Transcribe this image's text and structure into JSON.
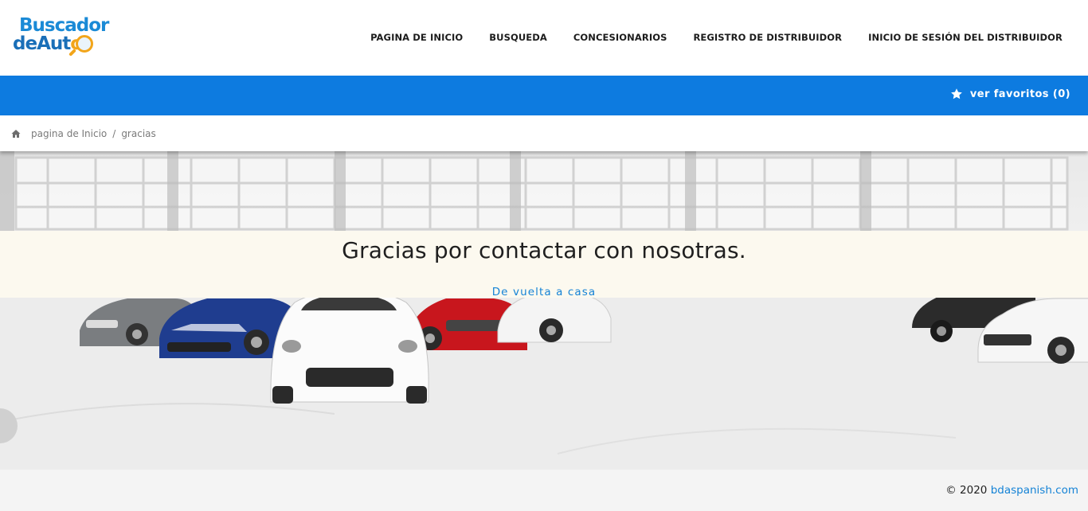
{
  "logo": {
    "line1": "Buscador",
    "line2_a": "deAut",
    "line2_b": "o"
  },
  "nav": [
    {
      "label": "PAGINA DE INICIO"
    },
    {
      "label": "BUSQUEDA"
    },
    {
      "label": "CONCESIONARIOS"
    },
    {
      "label": "REGISTRO DE DISTRIBUIDOR"
    },
    {
      "label": "INICIO DE SESIÓN DEL DISTRIBUIDOR"
    }
  ],
  "favorites": {
    "label": "ver favoritos (0)"
  },
  "breadcrumb": {
    "home": "pagina de Inicio",
    "separator": "/",
    "current": "gracias"
  },
  "message": {
    "heading": "Gracias por contactar con nosotras.",
    "link": "De vuelta a casa"
  },
  "footer": {
    "copyright": "© 2020",
    "site": "bdaspanish.com"
  },
  "colors": {
    "brand_blue": "#0d7be0",
    "link_blue": "#1583d6",
    "logo_orange": "#f2a51a",
    "message_bg": "#fcf9ef",
    "footer_bg": "#f4f4f4"
  },
  "icons": {
    "favorites": "star-icon",
    "home": "home-icon",
    "logo": "magnifier-icon"
  }
}
